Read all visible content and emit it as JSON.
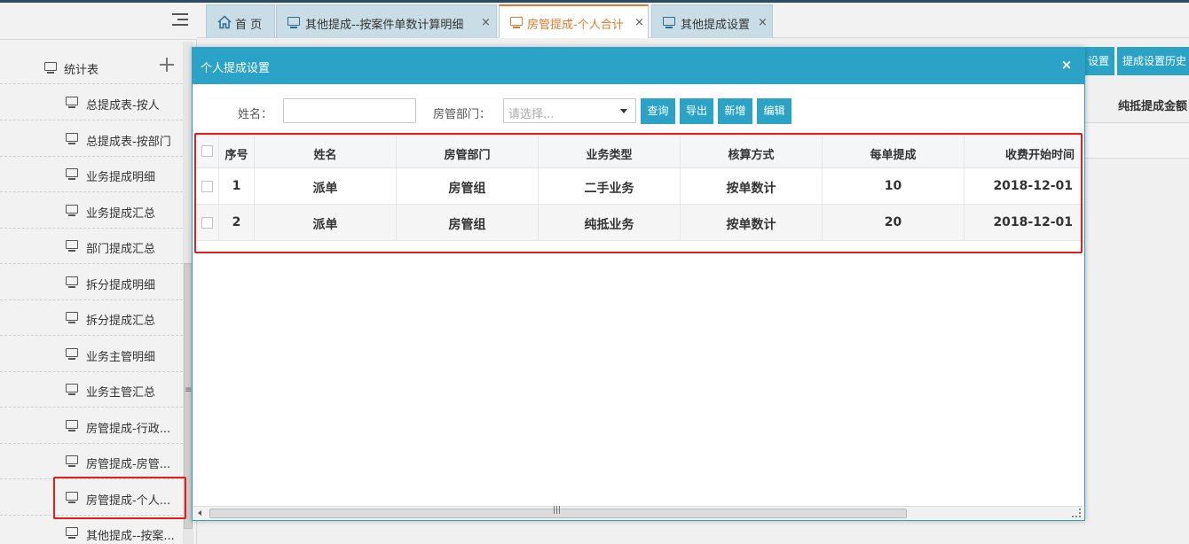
{
  "sidebar": {
    "group_label": "统计表",
    "items": [
      {
        "label": "总提成表-按人"
      },
      {
        "label": "总提成表-按部门"
      },
      {
        "label": "业务提成明细"
      },
      {
        "label": "业务提成汇总"
      },
      {
        "label": "部门提成汇总"
      },
      {
        "label": "拆分提成明细"
      },
      {
        "label": "拆分提成汇总"
      },
      {
        "label": "业务主管明细"
      },
      {
        "label": "业务主管汇总"
      },
      {
        "label": "房管提成-行政..."
      },
      {
        "label": "房管提成-房管..."
      },
      {
        "label": "房管提成-个人..."
      },
      {
        "label": "其他提成--按案..."
      }
    ]
  },
  "tabs": [
    {
      "label": "首 页"
    },
    {
      "label": "其他提成--按案件单数计算明细",
      "close": "×"
    },
    {
      "label": "房管提成-个人合计",
      "close": "×"
    },
    {
      "label": "其他提成设置",
      "close": "×"
    }
  ],
  "background": {
    "toolbar_buttons": [
      "设置",
      "提成设置历史"
    ],
    "column_header": "纯抵提成金额"
  },
  "dialog": {
    "title": "个人提成设置",
    "close": "×",
    "filters": {
      "name_label": "姓名：",
      "name_value": "",
      "dept_label": "房管部门：",
      "dept_placeholder": "请选择..."
    },
    "buttons": {
      "query": "查询",
      "export": "导出",
      "add": "新增",
      "edit": "编辑"
    },
    "table": {
      "headers": [
        "序号",
        "姓名",
        "房管部门",
        "业务类型",
        "核算方式",
        "每单提成",
        "收费开始时间"
      ],
      "rows": [
        [
          "1",
          "派单",
          "房管组",
          "二手业务",
          "按单数计",
          "10",
          "2018-12-01"
        ],
        [
          "2",
          "派单",
          "房管组",
          "纯抵业务",
          "按单数计",
          "20",
          "2018-12-01"
        ]
      ]
    },
    "scroll_grip": "|||"
  },
  "colors": {
    "accent": "#2ba3c6",
    "active_tab": "#e07a2a",
    "highlight": "#e0201d"
  }
}
